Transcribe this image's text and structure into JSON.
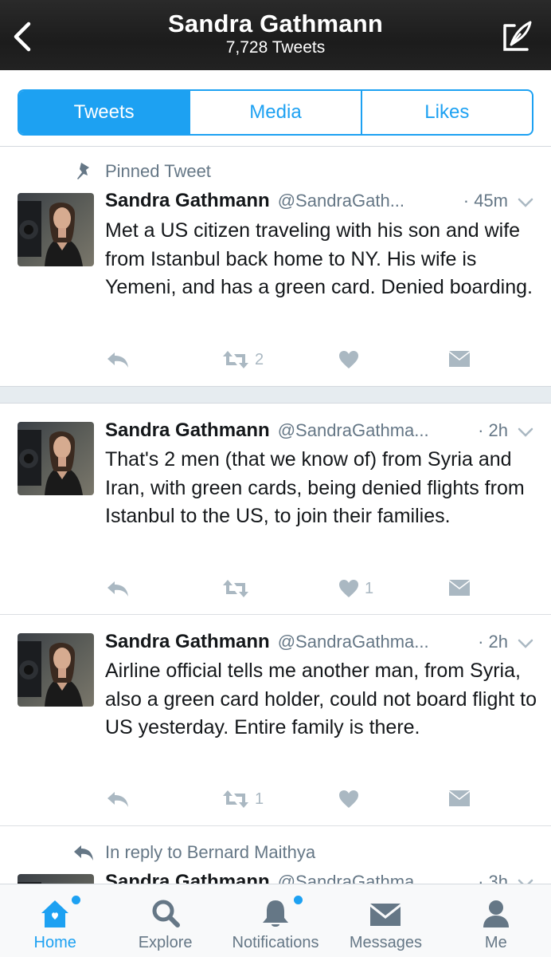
{
  "header": {
    "title": "Sandra Gathmann",
    "subtitle": "7,728 Tweets"
  },
  "segments": [
    {
      "label": "Tweets",
      "active": true
    },
    {
      "label": "Media",
      "active": false
    },
    {
      "label": "Likes",
      "active": false
    }
  ],
  "tweets": [
    {
      "context": "Pinned Tweet",
      "name": "Sandra Gathmann",
      "handle": "@SandraGath...",
      "time": "· 45m",
      "text": "Met a US citizen traveling with his son and wife from Istanbul back home to NY. His wife is Yemeni, and has a green card. Denied boarding.",
      "retweets": "2",
      "likes": ""
    },
    {
      "context": "",
      "name": "Sandra Gathmann",
      "handle": "@SandraGathma...",
      "time": "· 2h",
      "text": "That's 2 men (that we know of) from Syria and Iran, with green cards, being denied flights from Istanbul to the US, to join their families.",
      "retweets": "",
      "likes": "1"
    },
    {
      "context": "",
      "name": "Sandra Gathmann",
      "handle": "@SandraGathma...",
      "time": "· 2h",
      "text": "Airline official tells me another man, from Syria, also a green card holder, could not board flight to US yesterday. Entire family is there.",
      "retweets": "1",
      "likes": ""
    },
    {
      "context": "In reply to Bernard Maithya",
      "name": "Sandra Gathmann",
      "handle": "@SandraGathma...",
      "time": "· 3h",
      "text": "",
      "retweets": "",
      "likes": ""
    }
  ],
  "tabbar": [
    {
      "label": "Home",
      "icon": "home-icon",
      "active": true
    },
    {
      "label": "Explore",
      "icon": "search-icon",
      "active": false
    },
    {
      "label": "Notifications",
      "icon": "bell-icon",
      "active": false
    },
    {
      "label": "Messages",
      "icon": "envelope-icon",
      "active": false
    },
    {
      "label": "Me",
      "icon": "person-icon",
      "active": false
    }
  ],
  "colors": {
    "accent": "#1da1f2",
    "icon_gray": "#aab8c2",
    "secondary_text": "#657786"
  }
}
